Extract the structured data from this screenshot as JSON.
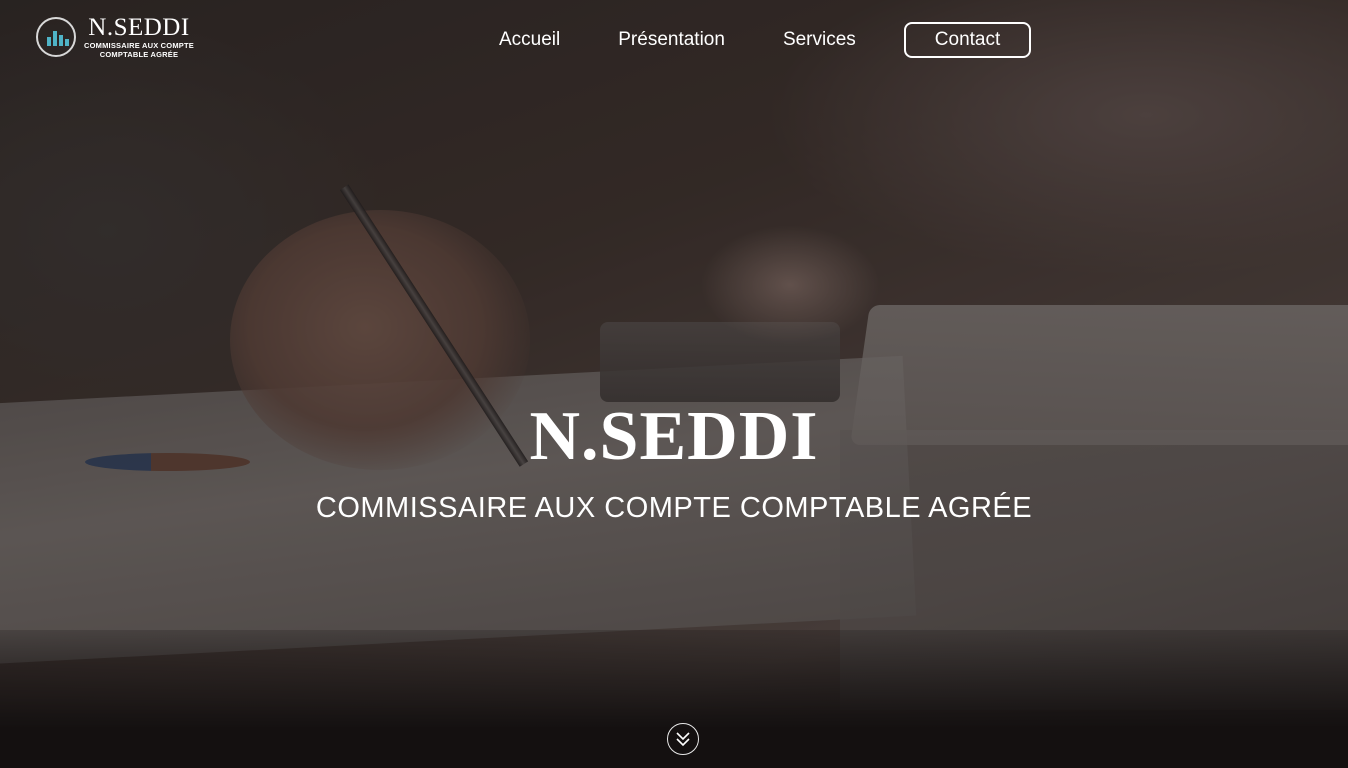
{
  "brand": {
    "name": "N.SEDDI",
    "tagline_line1": "COMMISSAIRE AUX COMPTE",
    "tagline_line2": "COMPTABLE AGRÉE",
    "logo_icon": "bar-chart-circle-icon",
    "accent_color": "#4fb3c6"
  },
  "nav": {
    "items": [
      {
        "label": "Accueil"
      },
      {
        "label": "Présentation"
      },
      {
        "label": "Services"
      }
    ],
    "contact_label": "Contact"
  },
  "hero": {
    "title": "N.SEDDI",
    "subtitle": "COMMISSAIRE AUX COMPTE COMPTABLE AGRÉE",
    "scroll_icon": "double-chevron-down-icon",
    "background_image": "accountant-desk-photo"
  }
}
